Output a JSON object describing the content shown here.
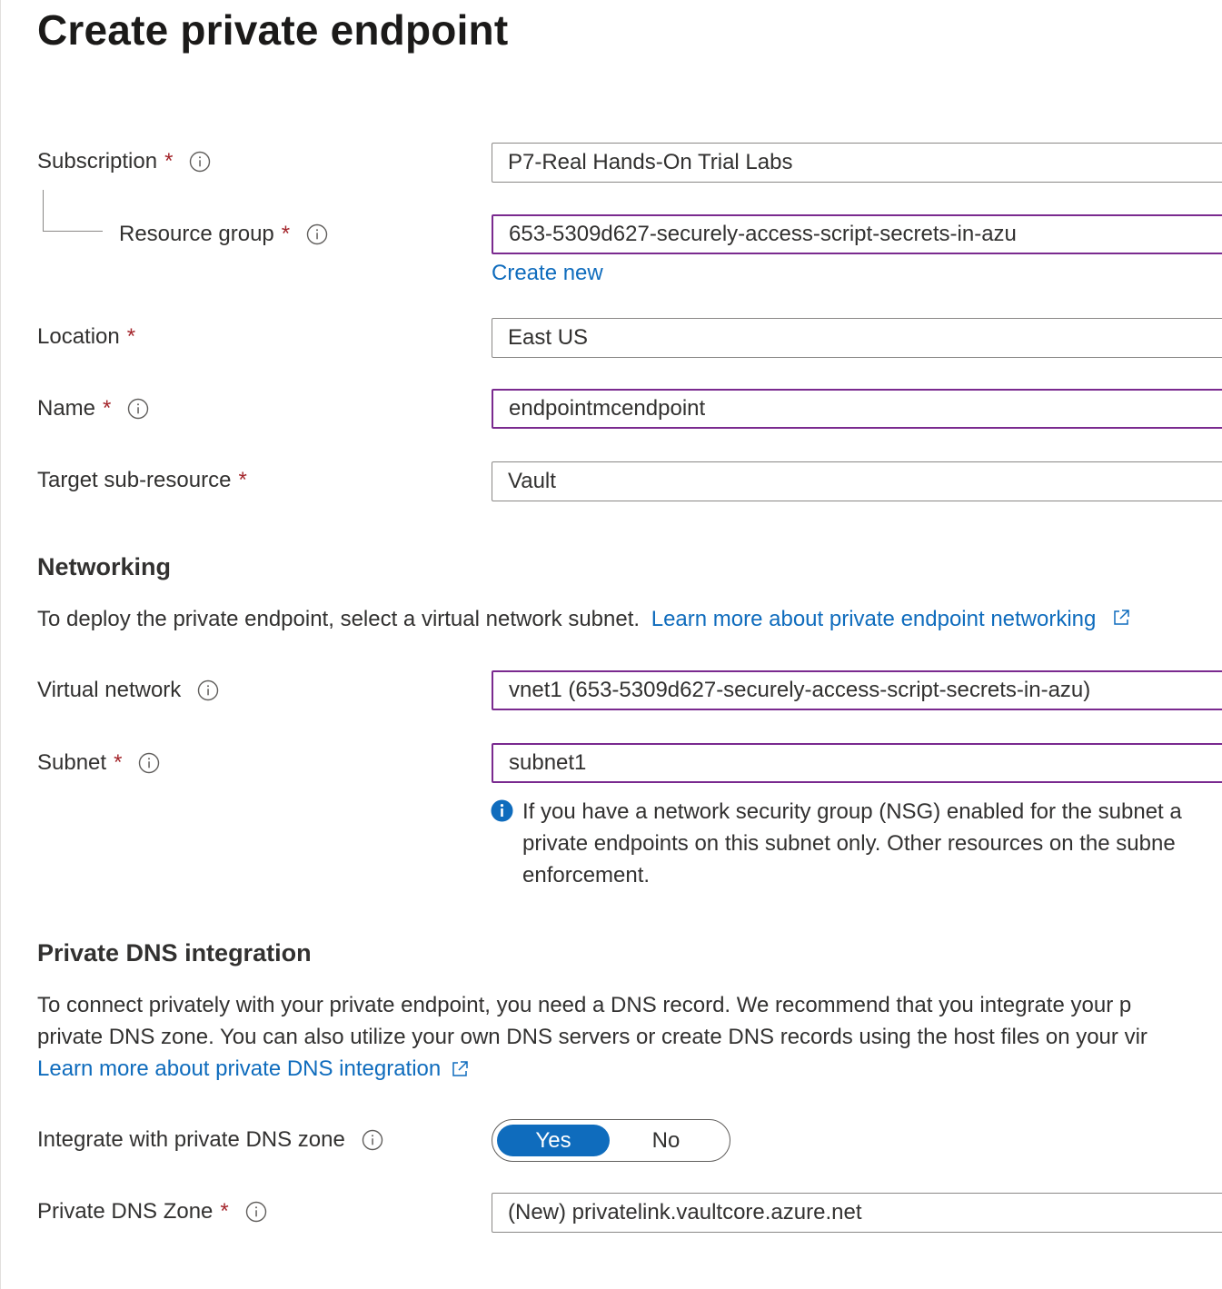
{
  "page": {
    "title": "Create private endpoint"
  },
  "basics": {
    "subscription": {
      "label": "Subscription",
      "required": "*",
      "value": "P7-Real Hands-On Trial Labs"
    },
    "resource_group": {
      "label": "Resource group",
      "required": "*",
      "value": "653-5309d627-securely-access-script-secrets-in-azu",
      "create_new": "Create new"
    },
    "location": {
      "label": "Location",
      "required": "*",
      "value": "East US"
    },
    "name": {
      "label": "Name",
      "required": "*",
      "value": "endpointmcendpoint"
    },
    "target_sub_resource": {
      "label": "Target sub-resource",
      "required": "*",
      "value": "Vault"
    }
  },
  "networking": {
    "heading": "Networking",
    "description": "To deploy the private endpoint, select a virtual network subnet.",
    "learn_more": "Learn more about private endpoint networking",
    "virtual_network": {
      "label": "Virtual network",
      "value": "vnet1 (653-5309d627-securely-access-script-secrets-in-azu)"
    },
    "subnet": {
      "label": "Subnet",
      "required": "*",
      "value": "subnet1"
    },
    "info_lines": [
      "If you have a network security group (NSG) enabled for the subnet a",
      "private endpoints on this subnet only. Other resources on the subne",
      "enforcement."
    ]
  },
  "dns": {
    "heading": "Private DNS integration",
    "description_lines": [
      "To connect privately with your private endpoint, you need a DNS record. We recommend that you integrate your p",
      "private DNS zone. You can also utilize your own DNS servers or create DNS records using the host files on your vir"
    ],
    "learn_more": "Learn more about private DNS integration",
    "integrate": {
      "label": "Integrate with private DNS zone",
      "yes": "Yes",
      "no": "No",
      "selected": "Yes"
    },
    "zone": {
      "label": "Private DNS Zone",
      "required": "*",
      "value": "(New) privatelink.vaultcore.azure.net"
    }
  },
  "colors": {
    "accent": "#0f6cbd",
    "required": "#a4262c",
    "focus_border": "#7a2a8f"
  }
}
